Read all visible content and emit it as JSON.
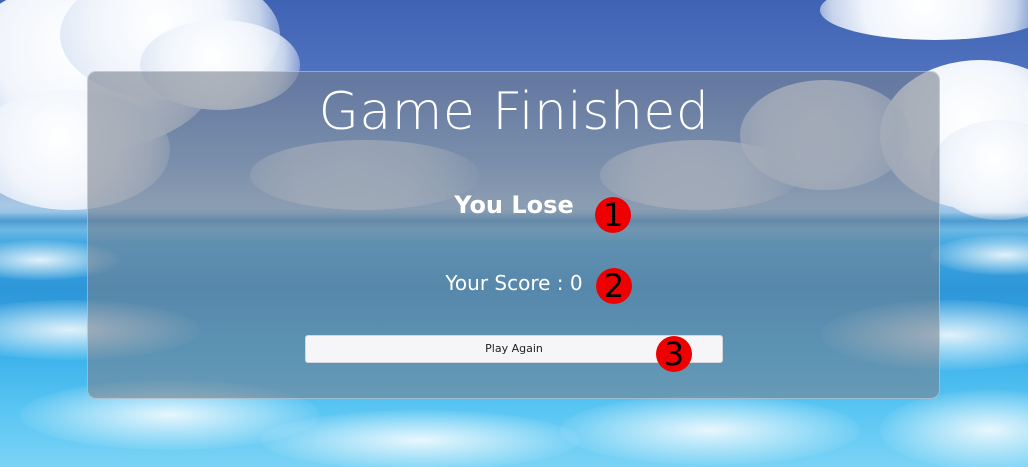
{
  "game": {
    "title": "Game Finished",
    "result": "You Lose",
    "score_label": "Your Score : ",
    "score_value": "0",
    "play_again_label": "Play Again"
  },
  "markers": [
    "1",
    "2",
    "3"
  ],
  "colors": {
    "panel": "#767e8c",
    "marker": "#ee0000",
    "button": "#f6f6f8",
    "text": "#ffffff"
  }
}
